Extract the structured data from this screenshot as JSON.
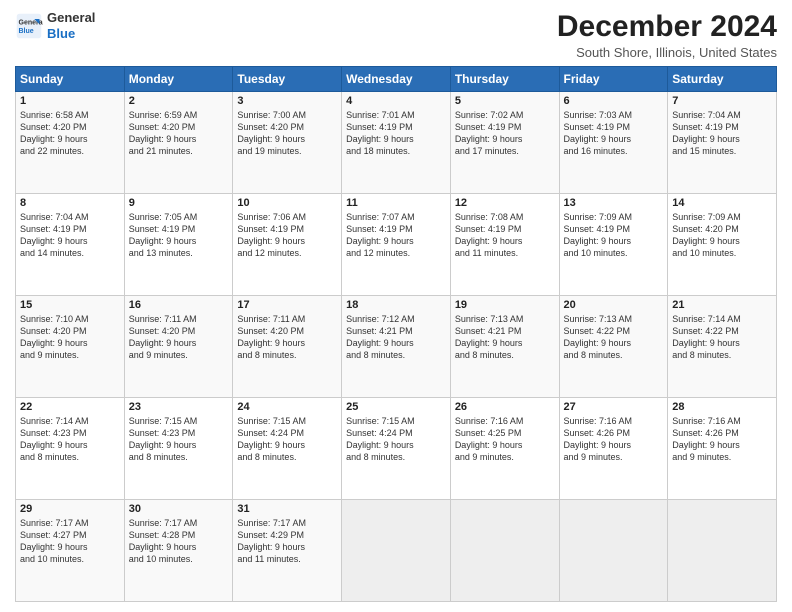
{
  "logo": {
    "line1": "General",
    "line2": "Blue"
  },
  "title": "December 2024",
  "subtitle": "South Shore, Illinois, United States",
  "days_of_week": [
    "Sunday",
    "Monday",
    "Tuesday",
    "Wednesday",
    "Thursday",
    "Friday",
    "Saturday"
  ],
  "weeks": [
    [
      {
        "day": "1",
        "lines": [
          "Sunrise: 6:58 AM",
          "Sunset: 4:20 PM",
          "Daylight: 9 hours",
          "and 22 minutes."
        ]
      },
      {
        "day": "2",
        "lines": [
          "Sunrise: 6:59 AM",
          "Sunset: 4:20 PM",
          "Daylight: 9 hours",
          "and 21 minutes."
        ]
      },
      {
        "day": "3",
        "lines": [
          "Sunrise: 7:00 AM",
          "Sunset: 4:20 PM",
          "Daylight: 9 hours",
          "and 19 minutes."
        ]
      },
      {
        "day": "4",
        "lines": [
          "Sunrise: 7:01 AM",
          "Sunset: 4:19 PM",
          "Daylight: 9 hours",
          "and 18 minutes."
        ]
      },
      {
        "day": "5",
        "lines": [
          "Sunrise: 7:02 AM",
          "Sunset: 4:19 PM",
          "Daylight: 9 hours",
          "and 17 minutes."
        ]
      },
      {
        "day": "6",
        "lines": [
          "Sunrise: 7:03 AM",
          "Sunset: 4:19 PM",
          "Daylight: 9 hours",
          "and 16 minutes."
        ]
      },
      {
        "day": "7",
        "lines": [
          "Sunrise: 7:04 AM",
          "Sunset: 4:19 PM",
          "Daylight: 9 hours",
          "and 15 minutes."
        ]
      }
    ],
    [
      {
        "day": "8",
        "lines": [
          "Sunrise: 7:04 AM",
          "Sunset: 4:19 PM",
          "Daylight: 9 hours",
          "and 14 minutes."
        ]
      },
      {
        "day": "9",
        "lines": [
          "Sunrise: 7:05 AM",
          "Sunset: 4:19 PM",
          "Daylight: 9 hours",
          "and 13 minutes."
        ]
      },
      {
        "day": "10",
        "lines": [
          "Sunrise: 7:06 AM",
          "Sunset: 4:19 PM",
          "Daylight: 9 hours",
          "and 12 minutes."
        ]
      },
      {
        "day": "11",
        "lines": [
          "Sunrise: 7:07 AM",
          "Sunset: 4:19 PM",
          "Daylight: 9 hours",
          "and 12 minutes."
        ]
      },
      {
        "day": "12",
        "lines": [
          "Sunrise: 7:08 AM",
          "Sunset: 4:19 PM",
          "Daylight: 9 hours",
          "and 11 minutes."
        ]
      },
      {
        "day": "13",
        "lines": [
          "Sunrise: 7:09 AM",
          "Sunset: 4:19 PM",
          "Daylight: 9 hours",
          "and 10 minutes."
        ]
      },
      {
        "day": "14",
        "lines": [
          "Sunrise: 7:09 AM",
          "Sunset: 4:20 PM",
          "Daylight: 9 hours",
          "and 10 minutes."
        ]
      }
    ],
    [
      {
        "day": "15",
        "lines": [
          "Sunrise: 7:10 AM",
          "Sunset: 4:20 PM",
          "Daylight: 9 hours",
          "and 9 minutes."
        ]
      },
      {
        "day": "16",
        "lines": [
          "Sunrise: 7:11 AM",
          "Sunset: 4:20 PM",
          "Daylight: 9 hours",
          "and 9 minutes."
        ]
      },
      {
        "day": "17",
        "lines": [
          "Sunrise: 7:11 AM",
          "Sunset: 4:20 PM",
          "Daylight: 9 hours",
          "and 8 minutes."
        ]
      },
      {
        "day": "18",
        "lines": [
          "Sunrise: 7:12 AM",
          "Sunset: 4:21 PM",
          "Daylight: 9 hours",
          "and 8 minutes."
        ]
      },
      {
        "day": "19",
        "lines": [
          "Sunrise: 7:13 AM",
          "Sunset: 4:21 PM",
          "Daylight: 9 hours",
          "and 8 minutes."
        ]
      },
      {
        "day": "20",
        "lines": [
          "Sunrise: 7:13 AM",
          "Sunset: 4:22 PM",
          "Daylight: 9 hours",
          "and 8 minutes."
        ]
      },
      {
        "day": "21",
        "lines": [
          "Sunrise: 7:14 AM",
          "Sunset: 4:22 PM",
          "Daylight: 9 hours",
          "and 8 minutes."
        ]
      }
    ],
    [
      {
        "day": "22",
        "lines": [
          "Sunrise: 7:14 AM",
          "Sunset: 4:23 PM",
          "Daylight: 9 hours",
          "and 8 minutes."
        ]
      },
      {
        "day": "23",
        "lines": [
          "Sunrise: 7:15 AM",
          "Sunset: 4:23 PM",
          "Daylight: 9 hours",
          "and 8 minutes."
        ]
      },
      {
        "day": "24",
        "lines": [
          "Sunrise: 7:15 AM",
          "Sunset: 4:24 PM",
          "Daylight: 9 hours",
          "and 8 minutes."
        ]
      },
      {
        "day": "25",
        "lines": [
          "Sunrise: 7:15 AM",
          "Sunset: 4:24 PM",
          "Daylight: 9 hours",
          "and 8 minutes."
        ]
      },
      {
        "day": "26",
        "lines": [
          "Sunrise: 7:16 AM",
          "Sunset: 4:25 PM",
          "Daylight: 9 hours",
          "and 9 minutes."
        ]
      },
      {
        "day": "27",
        "lines": [
          "Sunrise: 7:16 AM",
          "Sunset: 4:26 PM",
          "Daylight: 9 hours",
          "and 9 minutes."
        ]
      },
      {
        "day": "28",
        "lines": [
          "Sunrise: 7:16 AM",
          "Sunset: 4:26 PM",
          "Daylight: 9 hours",
          "and 9 minutes."
        ]
      }
    ],
    [
      {
        "day": "29",
        "lines": [
          "Sunrise: 7:17 AM",
          "Sunset: 4:27 PM",
          "Daylight: 9 hours",
          "and 10 minutes."
        ]
      },
      {
        "day": "30",
        "lines": [
          "Sunrise: 7:17 AM",
          "Sunset: 4:28 PM",
          "Daylight: 9 hours",
          "and 10 minutes."
        ]
      },
      {
        "day": "31",
        "lines": [
          "Sunrise: 7:17 AM",
          "Sunset: 4:29 PM",
          "Daylight: 9 hours",
          "and 11 minutes."
        ]
      },
      {
        "day": "",
        "lines": []
      },
      {
        "day": "",
        "lines": []
      },
      {
        "day": "",
        "lines": []
      },
      {
        "day": "",
        "lines": []
      }
    ]
  ]
}
